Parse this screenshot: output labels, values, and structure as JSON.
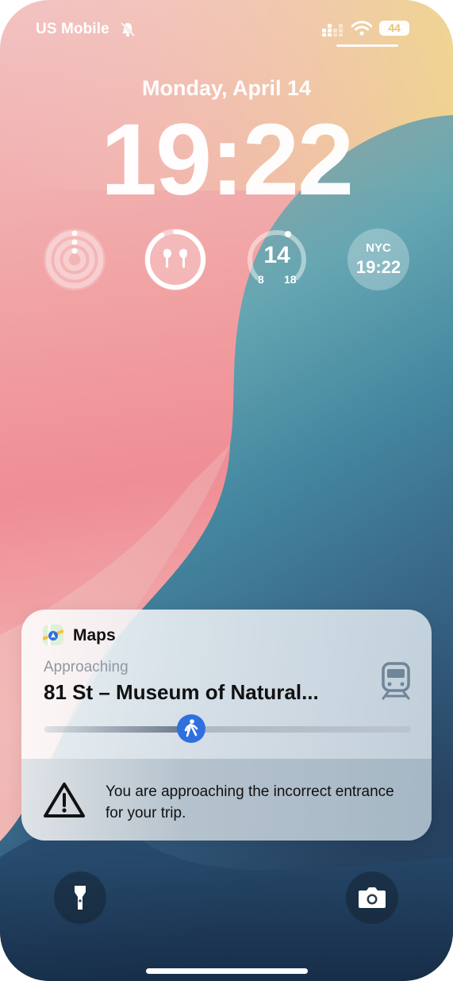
{
  "status_bar": {
    "carrier": "US Mobile",
    "battery_level": "44",
    "icons": [
      "bell-muted-icon",
      "cellular-signal-icon",
      "wifi-icon",
      "battery-icon"
    ]
  },
  "lock_screen": {
    "date": "Monday, April 14",
    "time": "19:22"
  },
  "widgets": {
    "activity": {
      "icon": "activity-rings-icon"
    },
    "airpods": {
      "icon": "airpods-icon",
      "battery_fraction": 0.92
    },
    "weather": {
      "temp": "14",
      "low": "8",
      "high": "18"
    },
    "world_clock": {
      "city": "NYC",
      "time": "19:22"
    }
  },
  "notification": {
    "app_name": "Maps",
    "label": "Approaching",
    "station": "81 St – Museum of Natural...",
    "progress_fraction": 0.4,
    "warning": "You are approaching the incorrect entrance for your trip.",
    "icons": [
      "maps-app-icon",
      "train-icon",
      "walking-person-icon",
      "warning-triangle-icon"
    ]
  },
  "quick_actions": {
    "left": "flashlight-icon",
    "right": "camera-icon"
  },
  "colors": {
    "accent_blue": "#2f6fe0",
    "battery_text": "#e8c27a"
  }
}
